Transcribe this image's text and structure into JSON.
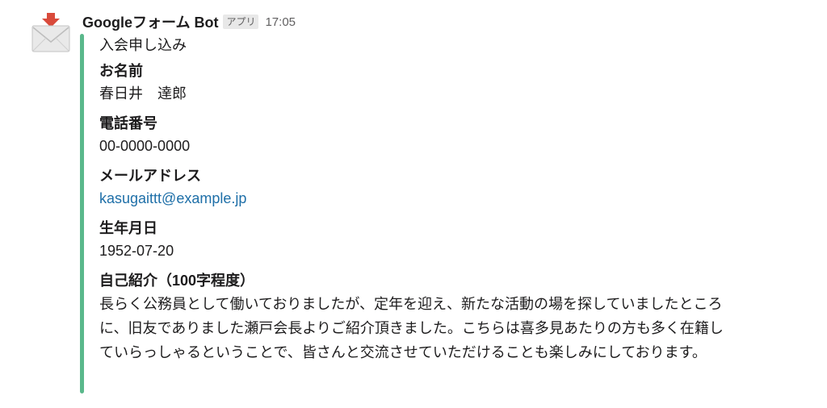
{
  "message": {
    "sender": "Googleフォーム Bot",
    "badge": "アプリ",
    "timestamp": "17:05",
    "avatar_icon": "incoming-envelope-icon",
    "accent_color": "#5ab88b",
    "attachment": {
      "title": "入会申し込み",
      "fields": [
        {
          "label": "お名前",
          "value": "春日井　達郎"
        },
        {
          "label": "電話番号",
          "value": "00-0000-0000"
        },
        {
          "label": "メールアドレス",
          "value": "kasugaittt@example.jp"
        },
        {
          "label": "生年月日",
          "value": "1952-07-20"
        },
        {
          "label": "自己紹介（100字程度）",
          "value": "長らく公務員として働いておりましたが、定年を迎え、新たな活動の場を探していましたところに、旧友でありました瀬戸会長よりご紹介頂きました。こちらは喜多見あたりの方も多く在籍していらっしゃるということで、皆さんと交流させていただけることも楽しみにしております。"
        }
      ]
    }
  }
}
